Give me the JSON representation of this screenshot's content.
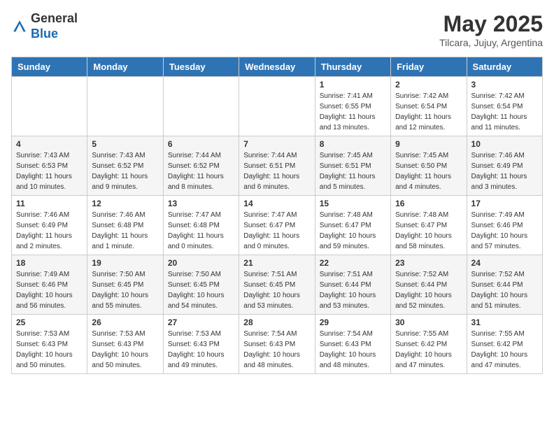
{
  "header": {
    "logo_general": "General",
    "logo_blue": "Blue",
    "month": "May 2025",
    "location": "Tilcara, Jujuy, Argentina"
  },
  "days_of_week": [
    "Sunday",
    "Monday",
    "Tuesday",
    "Wednesday",
    "Thursday",
    "Friday",
    "Saturday"
  ],
  "weeks": [
    [
      {
        "day": "",
        "info": ""
      },
      {
        "day": "",
        "info": ""
      },
      {
        "day": "",
        "info": ""
      },
      {
        "day": "",
        "info": ""
      },
      {
        "day": "1",
        "info": "Sunrise: 7:41 AM\nSunset: 6:55 PM\nDaylight: 11 hours\nand 13 minutes."
      },
      {
        "day": "2",
        "info": "Sunrise: 7:42 AM\nSunset: 6:54 PM\nDaylight: 11 hours\nand 12 minutes."
      },
      {
        "day": "3",
        "info": "Sunrise: 7:42 AM\nSunset: 6:54 PM\nDaylight: 11 hours\nand 11 minutes."
      }
    ],
    [
      {
        "day": "4",
        "info": "Sunrise: 7:43 AM\nSunset: 6:53 PM\nDaylight: 11 hours\nand 10 minutes."
      },
      {
        "day": "5",
        "info": "Sunrise: 7:43 AM\nSunset: 6:52 PM\nDaylight: 11 hours\nand 9 minutes."
      },
      {
        "day": "6",
        "info": "Sunrise: 7:44 AM\nSunset: 6:52 PM\nDaylight: 11 hours\nand 8 minutes."
      },
      {
        "day": "7",
        "info": "Sunrise: 7:44 AM\nSunset: 6:51 PM\nDaylight: 11 hours\nand 6 minutes."
      },
      {
        "day": "8",
        "info": "Sunrise: 7:45 AM\nSunset: 6:51 PM\nDaylight: 11 hours\nand 5 minutes."
      },
      {
        "day": "9",
        "info": "Sunrise: 7:45 AM\nSunset: 6:50 PM\nDaylight: 11 hours\nand 4 minutes."
      },
      {
        "day": "10",
        "info": "Sunrise: 7:46 AM\nSunset: 6:49 PM\nDaylight: 11 hours\nand 3 minutes."
      }
    ],
    [
      {
        "day": "11",
        "info": "Sunrise: 7:46 AM\nSunset: 6:49 PM\nDaylight: 11 hours\nand 2 minutes."
      },
      {
        "day": "12",
        "info": "Sunrise: 7:46 AM\nSunset: 6:48 PM\nDaylight: 11 hours\nand 1 minute."
      },
      {
        "day": "13",
        "info": "Sunrise: 7:47 AM\nSunset: 6:48 PM\nDaylight: 11 hours\nand 0 minutes."
      },
      {
        "day": "14",
        "info": "Sunrise: 7:47 AM\nSunset: 6:47 PM\nDaylight: 11 hours\nand 0 minutes."
      },
      {
        "day": "15",
        "info": "Sunrise: 7:48 AM\nSunset: 6:47 PM\nDaylight: 10 hours\nand 59 minutes."
      },
      {
        "day": "16",
        "info": "Sunrise: 7:48 AM\nSunset: 6:47 PM\nDaylight: 10 hours\nand 58 minutes."
      },
      {
        "day": "17",
        "info": "Sunrise: 7:49 AM\nSunset: 6:46 PM\nDaylight: 10 hours\nand 57 minutes."
      }
    ],
    [
      {
        "day": "18",
        "info": "Sunrise: 7:49 AM\nSunset: 6:46 PM\nDaylight: 10 hours\nand 56 minutes."
      },
      {
        "day": "19",
        "info": "Sunrise: 7:50 AM\nSunset: 6:45 PM\nDaylight: 10 hours\nand 55 minutes."
      },
      {
        "day": "20",
        "info": "Sunrise: 7:50 AM\nSunset: 6:45 PM\nDaylight: 10 hours\nand 54 minutes."
      },
      {
        "day": "21",
        "info": "Sunrise: 7:51 AM\nSunset: 6:45 PM\nDaylight: 10 hours\nand 53 minutes."
      },
      {
        "day": "22",
        "info": "Sunrise: 7:51 AM\nSunset: 6:44 PM\nDaylight: 10 hours\nand 53 minutes."
      },
      {
        "day": "23",
        "info": "Sunrise: 7:52 AM\nSunset: 6:44 PM\nDaylight: 10 hours\nand 52 minutes."
      },
      {
        "day": "24",
        "info": "Sunrise: 7:52 AM\nSunset: 6:44 PM\nDaylight: 10 hours\nand 51 minutes."
      }
    ],
    [
      {
        "day": "25",
        "info": "Sunrise: 7:53 AM\nSunset: 6:43 PM\nDaylight: 10 hours\nand 50 minutes."
      },
      {
        "day": "26",
        "info": "Sunrise: 7:53 AM\nSunset: 6:43 PM\nDaylight: 10 hours\nand 50 minutes."
      },
      {
        "day": "27",
        "info": "Sunrise: 7:53 AM\nSunset: 6:43 PM\nDaylight: 10 hours\nand 49 minutes."
      },
      {
        "day": "28",
        "info": "Sunrise: 7:54 AM\nSunset: 6:43 PM\nDaylight: 10 hours\nand 48 minutes."
      },
      {
        "day": "29",
        "info": "Sunrise: 7:54 AM\nSunset: 6:43 PM\nDaylight: 10 hours\nand 48 minutes."
      },
      {
        "day": "30",
        "info": "Sunrise: 7:55 AM\nSunset: 6:42 PM\nDaylight: 10 hours\nand 47 minutes."
      },
      {
        "day": "31",
        "info": "Sunrise: 7:55 AM\nSunset: 6:42 PM\nDaylight: 10 hours\nand 47 minutes."
      }
    ]
  ]
}
